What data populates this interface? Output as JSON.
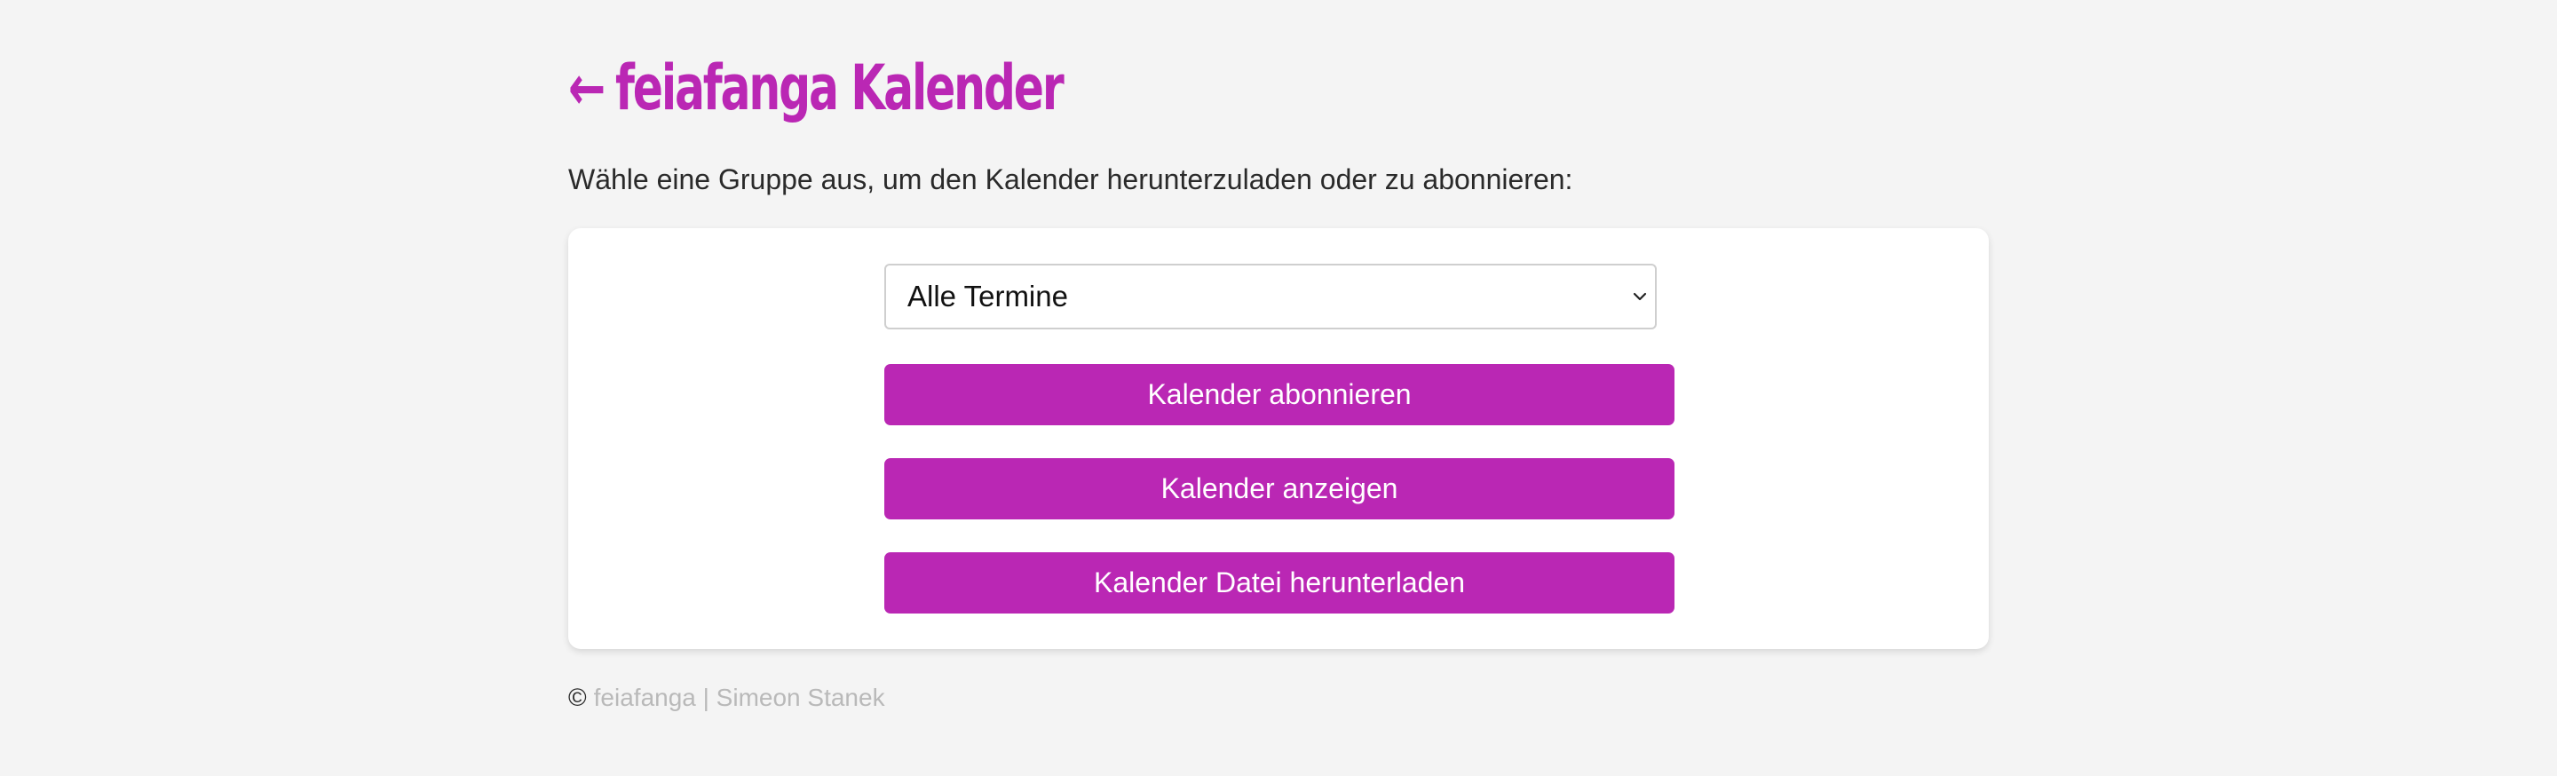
{
  "header": {
    "back_arrow": "←",
    "title": "feiafanga Kalender"
  },
  "intro": {
    "text": "Wähle eine Gruppe aus, um den Kalender herunterzuladen oder zu abonnieren:"
  },
  "group_select": {
    "selected": "Alle Termine",
    "icon": "chevron-down-icon"
  },
  "buttons": {
    "subscribe": "Kalender abonnieren",
    "view": "Kalender anzeigen",
    "download": "Kalender Datei herunterladen"
  },
  "footer": {
    "copyright_symbol": "©",
    "text": "feiafanga | Simeon Stanek"
  },
  "colors": {
    "accent": "#ba27b4",
    "background": "#f4f4f4",
    "card": "#ffffff",
    "footer_text": "#b9b9b9"
  }
}
